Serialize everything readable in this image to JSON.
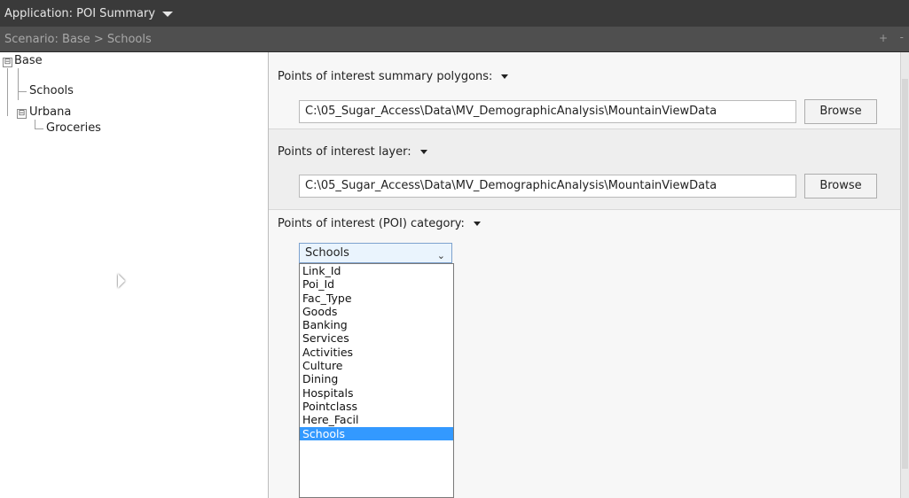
{
  "header": {
    "application_label": "Application:  POI Summary",
    "scenario_label": "Scenario:  Base > Schools",
    "add_glyph": "+",
    "remove_glyph": "-"
  },
  "tree": {
    "root": {
      "label": "Base",
      "expander": "⊟"
    },
    "schools": {
      "label": "Schools"
    },
    "urbana": {
      "label": "Urbana",
      "expander": "⊟"
    },
    "groceries": {
      "label": "Groceries"
    }
  },
  "form": {
    "polygons_label": "Points of interest summary polygons:",
    "polygons_path": "C:\\05_Sugar_Access\\Data\\MV_DemographicAnalysis\\MountainViewData",
    "layer_label": "Points of interest layer:",
    "layer_path": "C:\\05_Sugar_Access\\Data\\MV_DemographicAnalysis\\MountainViewData",
    "browse_label": "Browse",
    "category_label": "Points of interest (POI) category:",
    "category_selected": "Schools",
    "category_options": [
      "Link_Id",
      "Poi_Id",
      "Fac_Type",
      "Goods",
      "Banking",
      "Services",
      "Activities",
      "Culture",
      "Dining",
      "Hospitals",
      "Pointclass",
      "Here_Facil",
      "Schools"
    ]
  },
  "colors": {
    "appbar_bg": "#3a3a3a",
    "scenbar_bg": "#4f4f4f",
    "selection": "#3399ff"
  }
}
